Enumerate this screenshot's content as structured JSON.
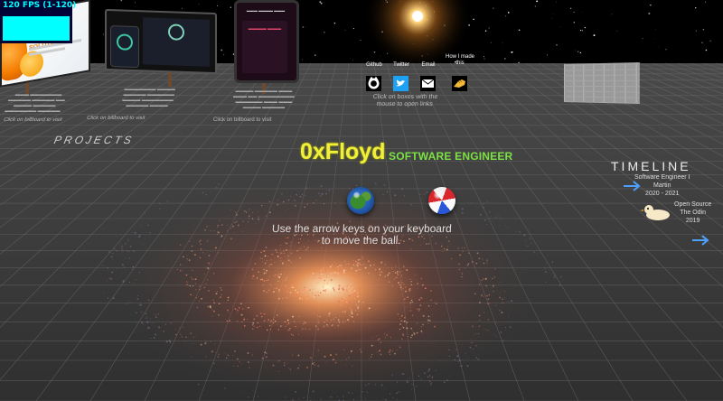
{
  "fps": {
    "text": "120 FPS (1-120)",
    "fill_fraction": 0.82
  },
  "header_links": [
    {
      "label": "Github",
      "icon": "github-icon"
    },
    {
      "label": "Twitter",
      "icon": "twitter-icon"
    },
    {
      "label": "Email",
      "icon": "email-icon"
    },
    {
      "label": "How I made this",
      "icon": "hand-icon"
    }
  ],
  "brand": {
    "name": "0xFloyd",
    "role": "SOFTWARE ENGINEER"
  },
  "instructions": "Use the arrow keys on your keyboard to move the ball.",
  "click_boxes": "Click on boxes with the mouse to open links",
  "projects_label": "PROJECTS",
  "timeline_label": "TIMELINE",
  "billboards": [
    {
      "title": "THE EXPERT SOLUTION",
      "caption": "Click on billboard to visit"
    },
    {
      "caption": "Click on billboard to visit"
    },
    {
      "caption": "Click on billboard to visit"
    }
  ],
  "timeline": [
    {
      "lines": [
        "Software Engineer I",
        "Martin",
        "2020 - 2021"
      ]
    },
    {
      "lines": [
        "Open Source",
        "The Odin",
        "2019"
      ]
    }
  ],
  "colors": {
    "brand_name": "#f0f038",
    "brand_role": "#7be243",
    "fps_bg": "#020233",
    "fps_fg": "#00ffff",
    "ground": "#3b3b3b",
    "grid": "#6a6a6a"
  }
}
